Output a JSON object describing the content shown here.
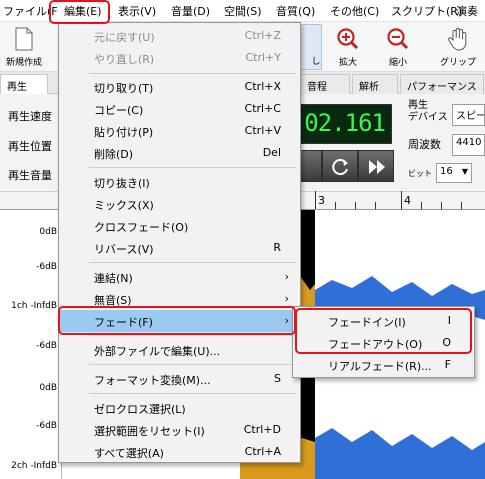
{
  "menubar": {
    "items": [
      {
        "label": "ファイル(F"
      },
      {
        "label": "編集(E)"
      },
      {
        "label": "表示(V)"
      },
      {
        "label": "音量(D)"
      },
      {
        "label": "空間(S)"
      },
      {
        "label": "音質(Q)"
      },
      {
        "label": "その他(C)"
      },
      {
        "label": "スクリプト(R)"
      },
      {
        "label": "演奏"
      }
    ]
  },
  "toolbar": {
    "new": "新規作成",
    "hidden": "し",
    "zoom_in": "拡大",
    "zoom_out": "縮小",
    "grip": "グリップ"
  },
  "tabs": [
    "再生",
    "音程",
    "解析",
    "パフォーマンス"
  ],
  "panel": {
    "speed_label": "再生速度",
    "position_label": "再生位置",
    "volume_label": "再生音量",
    "time_display": "02.161",
    "device_label": "再生\nデバイス",
    "device_value": "スピー",
    "freq_label": "周波数",
    "freq_value": "4410",
    "bit_label": "ビット",
    "bit_value": "16"
  },
  "ruler": {
    "marks": [
      "3",
      "4"
    ]
  },
  "waveform": {
    "db_labels": [
      "0dB",
      "-6dB",
      "1ch -InfdB",
      "-6dB",
      "0dB",
      "-6dB",
      "2ch -InfdB"
    ]
  },
  "edit_menu": {
    "items": [
      {
        "label": "元に戻す(U)",
        "shortcut": "Ctrl+Z",
        "disabled": true
      },
      {
        "label": "やり直し(R)",
        "shortcut": "Ctrl+Y",
        "disabled": true
      },
      {
        "label": "切り取り(T)",
        "shortcut": "Ctrl+X"
      },
      {
        "label": "コピー(C)",
        "shortcut": "Ctrl+C"
      },
      {
        "label": "貼り付け(P)",
        "shortcut": "Ctrl+V"
      },
      {
        "label": "削除(D)",
        "shortcut": "Del"
      },
      {
        "label": "切り抜き(I)",
        "shortcut": ""
      },
      {
        "label": "ミックス(X)",
        "shortcut": ""
      },
      {
        "label": "クロスフェード(O)",
        "shortcut": ""
      },
      {
        "label": "リバース(V)",
        "shortcut": "R"
      },
      {
        "label": "連結(N)",
        "shortcut": ""
      },
      {
        "label": "無音(S)",
        "shortcut": ""
      },
      {
        "label": "フェード(F)",
        "shortcut": ""
      },
      {
        "label": "外部ファイルで編集(U)...",
        "shortcut": ""
      },
      {
        "label": "フォーマット変換(M)...",
        "shortcut": "S"
      },
      {
        "label": "ゼロクロス選択(L)",
        "shortcut": ""
      },
      {
        "label": "選択範囲をリセット(I)",
        "shortcut": "Ctrl+D"
      },
      {
        "label": "すべて選択(A)",
        "shortcut": "Ctrl+A"
      }
    ],
    "submenu_arrow": "›"
  },
  "fade_submenu": {
    "items": [
      {
        "label": "フェードイン(I)",
        "shortcut": "I"
      },
      {
        "label": "フェードアウト(O)",
        "shortcut": "O"
      },
      {
        "label": "リアルフェード(R)...",
        "shortcut": "F"
      }
    ]
  },
  "colors": {
    "highlight_outline": "#e0151c",
    "menu_selection": "#9bc9ef",
    "waveform": "#2f6fd6",
    "waveform_selected": "#d99a1c",
    "lcd_text": "#3cf35a"
  }
}
